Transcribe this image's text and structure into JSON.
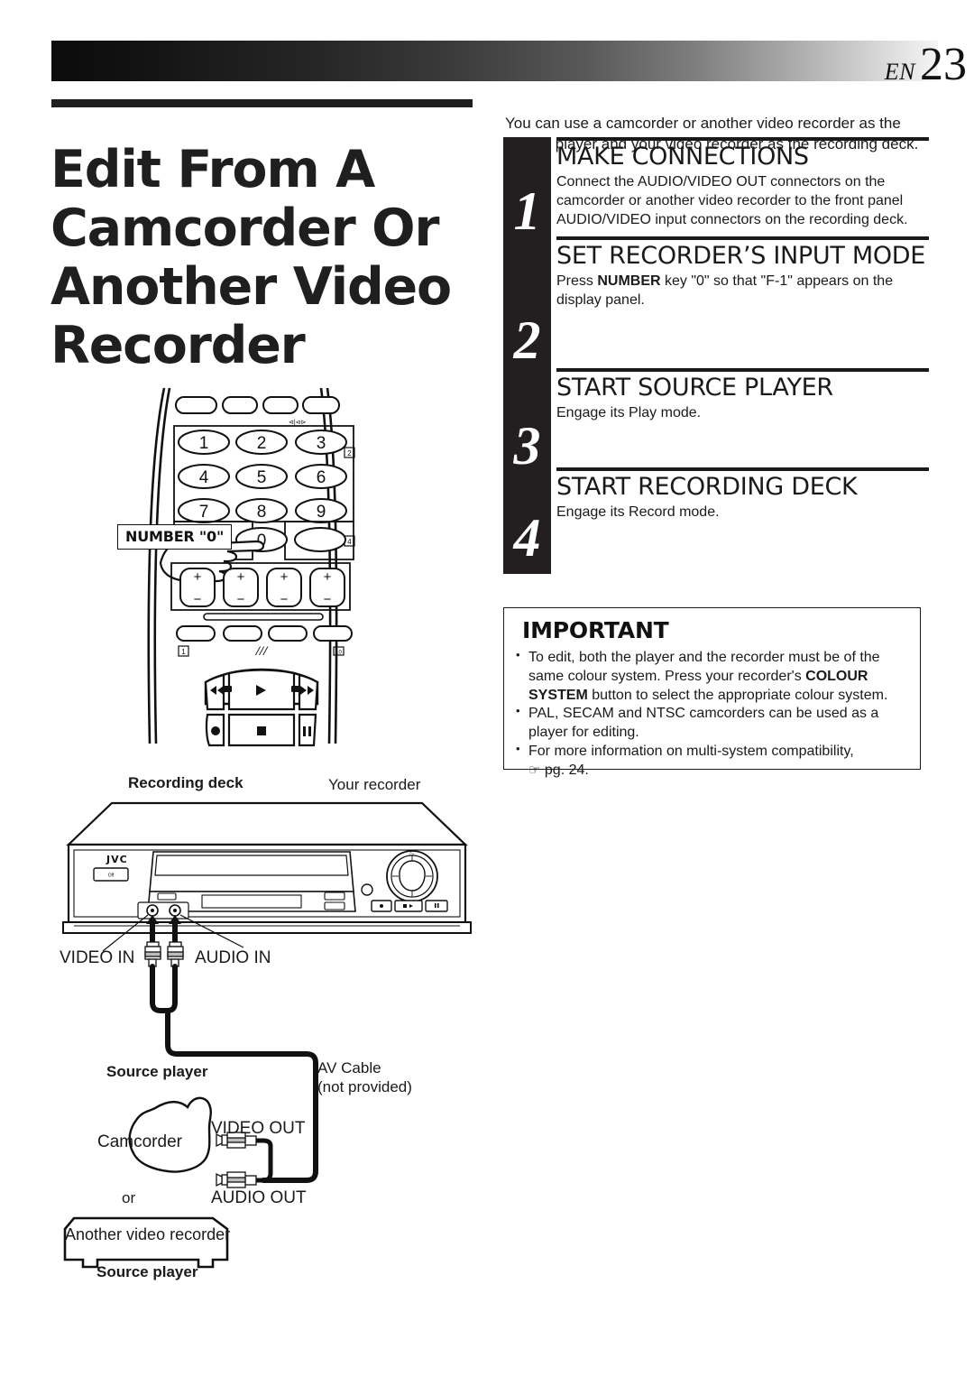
{
  "header": {
    "edition": "EN",
    "page_number": "23"
  },
  "title": {
    "line1": "Edit From A",
    "line2": "Camcorder Or",
    "line3": "Another Video",
    "line4": "Recorder"
  },
  "intro": {
    "text": "You can use a camcorder or another video recorder as the source player and your video recorder as the recording deck."
  },
  "steps": [
    {
      "number": "1",
      "heading": "MAKE CONNECTIONS",
      "body_pre": "Connect the AUDIO/VIDEO OUT connectors on the camcorder or another video recorder to the front panel AUDIO/VIDEO input connectors on the recording deck.",
      "body_bold": "",
      "body_post": ""
    },
    {
      "number": "2",
      "heading": "SET RECORDER’S INPUT MODE",
      "body_pre": "Press ",
      "body_bold": "NUMBER",
      "body_post": " key \"0\" so that \"F-1\" appears on the display panel."
    },
    {
      "number": "3",
      "heading": "START SOURCE PLAYER",
      "body_pre": "Engage its Play mode.",
      "body_bold": "",
      "body_post": ""
    },
    {
      "number": "4",
      "heading": "START RECORDING DECK",
      "body_pre": "Engage its Record mode.",
      "body_bold": "",
      "body_post": ""
    }
  ],
  "important": {
    "title": "IMPORTANT",
    "items": [
      {
        "pre": "To edit, both the player and the recorder must be of the same colour system. Press your recorder's ",
        "bold": "COLOUR SYSTEM",
        "post": " button to select the appropriate colour system."
      },
      {
        "pre": "PAL, SECAM and NTSC camcorders can be used as a player for editing.",
        "bold": "",
        "post": ""
      },
      {
        "pre": "For more information on multi-system compatibility, ",
        "bold": "",
        "post": " pg. 24.",
        "icon": "☞"
      }
    ]
  },
  "remote": {
    "callout_label": "NUMBER \"0\"",
    "keys": [
      "1",
      "2",
      "3",
      "4",
      "5",
      "6",
      "7",
      "8",
      "9",
      "0"
    ],
    "key_markers": [
      "2",
      "4",
      "1",
      "10"
    ],
    "transport_icons": [
      "rewind",
      "play",
      "fast-forward",
      "record",
      "stop",
      "pause"
    ],
    "volume_plus": "+",
    "volume_minus": "–"
  },
  "diagram": {
    "recording_deck_label": "Recording deck",
    "your_recorder_label": "Your recorder",
    "brand": "JVC",
    "power_button_label": "Off",
    "video_in_label": "VIDEO IN",
    "audio_in_label": "AUDIO IN",
    "av_cable_label_line1": "AV Cable",
    "av_cable_label_line2": "(not provided)",
    "source_player_top_label": "Source player",
    "camcorder_label": "Camcorder",
    "or_label": "or",
    "video_out_label": "VIDEO OUT",
    "audio_out_label": "AUDIO OUT",
    "another_video_recorder_label": "Another video recorder",
    "source_player_bottom_label": "Source player"
  },
  "colors": {
    "ink": "#1a1a1a",
    "step_column": "#231f20",
    "paper": "#ffffff"
  }
}
